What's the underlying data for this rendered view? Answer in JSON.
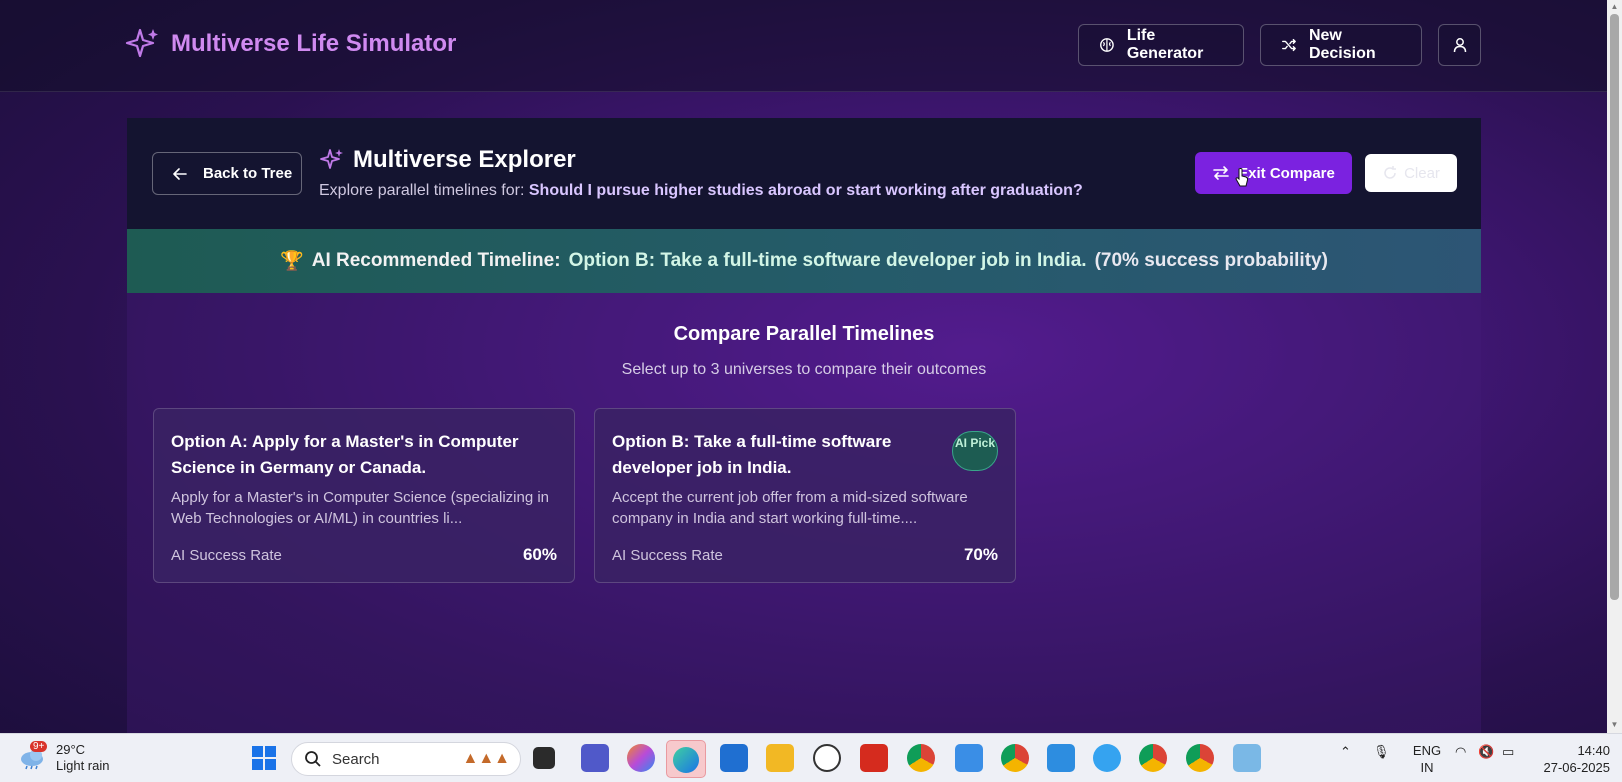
{
  "header": {
    "brand_title": "Multiverse Life Simulator",
    "life_generator_label": "Life Generator",
    "new_decision_label": "New Decision"
  },
  "explorer": {
    "back_label": "Back to Tree",
    "title": "Multiverse Explorer",
    "subtitle_prefix": "Explore parallel timelines for:",
    "question": "Should I pursue higher studies abroad or start working after graduation?",
    "exit_compare_label": "Exit Compare",
    "clear_label": "Clear"
  },
  "recommendation": {
    "prefix": "AI Recommended Timeline:",
    "option": "Option B: Take a full-time software developer job in India.",
    "probability": "(70% success probability)"
  },
  "compare": {
    "title": "Compare Parallel Timelines",
    "subtitle": "Select up to 3 universes to compare their outcomes",
    "cards": [
      {
        "title": "Option A: Apply for a Master's in Computer Science in Germany or Canada.",
        "description": "Apply for a Master's in Computer Science (specializing in Web Technologies or AI/ML) in countries li...",
        "rate_label": "AI Success Rate",
        "rate": "60%"
      },
      {
        "title": "Option B: Take a full-time software developer job in India.",
        "description": "Accept the current job offer from a mid-sized software company in India and start working full-time....",
        "rate_label": "AI Success Rate",
        "rate": "70%",
        "badge": "AI Pick"
      }
    ]
  },
  "taskbar": {
    "weather_badge": "9+",
    "temperature": "29°C",
    "weather_text": "Light rain",
    "search_placeholder": "Search",
    "lang": "ENG",
    "region": "IN",
    "time": "14:40",
    "date": "27-06-2025"
  },
  "colors": {
    "accent": "#7b22e0",
    "brand": "#d08af0"
  }
}
